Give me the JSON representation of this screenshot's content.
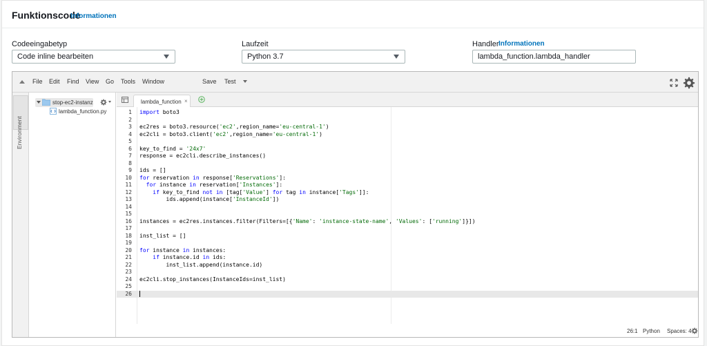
{
  "header": {
    "title": "Funktionscode",
    "info_link": "Informationen"
  },
  "fields": {
    "code_entry": {
      "label": "Codeeingabetyp",
      "value": "Code inline bearbeiten"
    },
    "runtime": {
      "label": "Laufzeit",
      "value": "Python 3.7"
    },
    "handler": {
      "label": "Handler",
      "info_link": "Informationen",
      "value": "lambda_function.lambda_handler"
    }
  },
  "ide": {
    "menu": [
      "File",
      "Edit",
      "Find",
      "View",
      "Go",
      "Tools",
      "Window"
    ],
    "save_label": "Save",
    "test_label": "Test",
    "environment_label": "Environment",
    "tree": {
      "folder": "stop-ec2-instanz",
      "file": "lambda_function.py"
    },
    "tab_label": "lambda_function",
    "code_lines": [
      "import boto3",
      "",
      "ec2res = boto3.resource('ec2',region_name='eu-central-1')",
      "ec2cli = boto3.client('ec2',region_name='eu-central-1')",
      "",
      "key_to_find = '24x7'",
      "response = ec2cli.describe_instances()",
      "",
      "ids = []",
      "for reservation in response['Reservations']:",
      "  for instance in reservation['Instances']:",
      "    if key_to_find not in [tag['Value'] for tag in instance['Tags']]:",
      "        ids.append(instance['InstanceId'])",
      "",
      "",
      "instances = ec2res.instances.filter(Filters=[{'Name': 'instance-state-name', 'Values': ['running']}])",
      "",
      "inst_list = []",
      "",
      "for instance in instances:",
      "    if instance.id in ids:",
      "        inst_list.append(instance.id)",
      "",
      "ec2cli.stop_instances(InstanceIds=inst_list)",
      "",
      ""
    ],
    "active_line": 26,
    "status": {
      "position": "26:1",
      "language": "Python",
      "spaces": "Spaces: 4"
    }
  },
  "icons": [
    "expand-icon",
    "settings-gear-icon",
    "folder-icon",
    "python-file-icon",
    "add-tab-icon",
    "panel-toggle-icon"
  ],
  "colors": {
    "link": "#0073bb",
    "keyword": "#0000ff",
    "string": "#036a07"
  }
}
